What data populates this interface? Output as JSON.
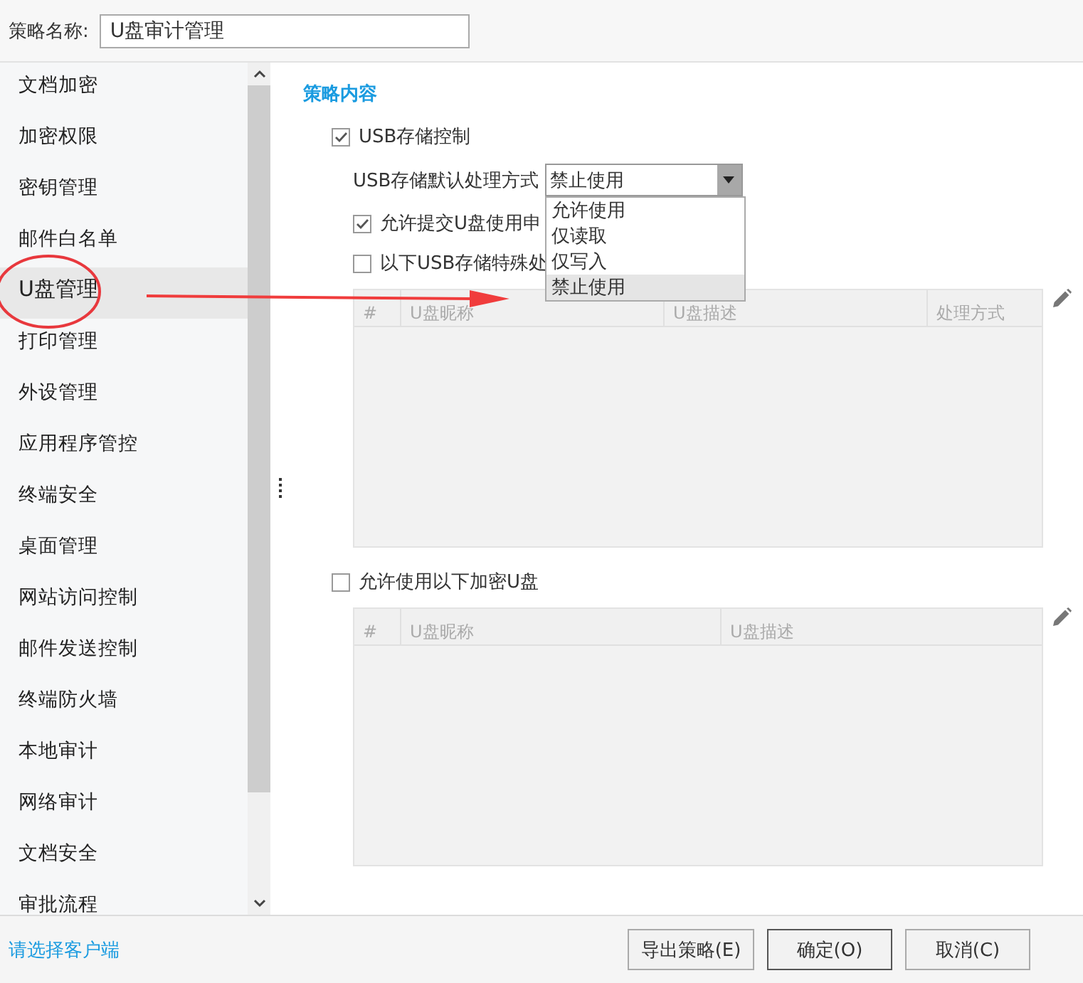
{
  "policy_name": {
    "label": "策略名称:",
    "value": "U盘审计管理"
  },
  "sidebar": {
    "items": [
      {
        "label": "文档加密",
        "selected": false
      },
      {
        "label": "加密权限",
        "selected": false
      },
      {
        "label": "密钥管理",
        "selected": false
      },
      {
        "label": "邮件白名单",
        "selected": false
      },
      {
        "label": "U盘管理",
        "selected": true
      },
      {
        "label": "打印管理",
        "selected": false
      },
      {
        "label": "外设管理",
        "selected": false
      },
      {
        "label": "应用程序管控",
        "selected": false
      },
      {
        "label": "终端安全",
        "selected": false
      },
      {
        "label": "桌面管理",
        "selected": false
      },
      {
        "label": "网站访问控制",
        "selected": false
      },
      {
        "label": "邮件发送控制",
        "selected": false
      },
      {
        "label": "终端防火墙",
        "selected": false
      },
      {
        "label": "本地审计",
        "selected": false
      },
      {
        "label": "网络审计",
        "selected": false
      },
      {
        "label": "文档安全",
        "selected": false
      },
      {
        "label": "审批流程",
        "selected": false
      }
    ]
  },
  "section_title": "策略内容",
  "usb_control": {
    "label": "USB存储控制",
    "checked": true
  },
  "default_mode": {
    "label": "USB存储默认处理方式",
    "value": "禁止使用",
    "options": [
      {
        "label": "允许使用",
        "selected": false
      },
      {
        "label": "仅读取",
        "selected": false
      },
      {
        "label": "仅写入",
        "selected": false
      },
      {
        "label": "禁止使用",
        "selected": true
      }
    ]
  },
  "allow_request": {
    "label": "允许提交U盘使用申",
    "checked": true
  },
  "special": {
    "label": "以下USB存储特殊处",
    "checked": false
  },
  "special_table": {
    "columns": [
      "#",
      "U盘昵称",
      "U盘描述",
      "处理方式"
    ]
  },
  "encrypted": {
    "label": "允许使用以下加密U盘",
    "checked": false
  },
  "encrypted_table": {
    "columns": [
      "#",
      "U盘昵称",
      "U盘描述"
    ]
  },
  "footer": {
    "link": "请选择客户端",
    "buttons": [
      {
        "label": "导出策略(E)",
        "default": false
      },
      {
        "label": "确定(O)",
        "default": true
      },
      {
        "label": "取消(C)",
        "default": false
      }
    ]
  }
}
